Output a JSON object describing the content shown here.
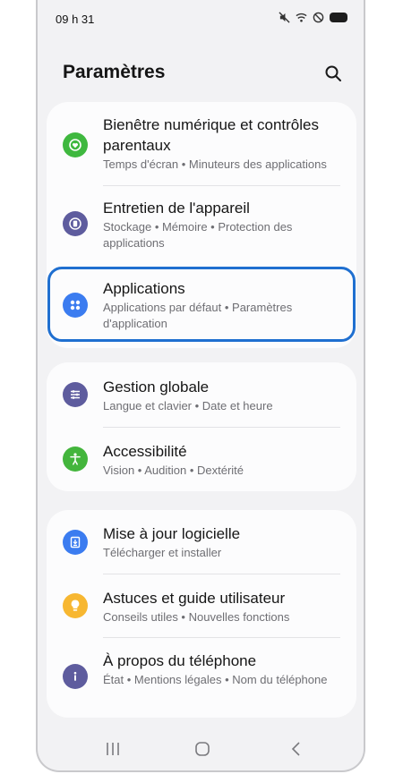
{
  "status_bar": {
    "time": "09 h 31",
    "icons": [
      "mute-icon",
      "wifi-icon",
      "do-not-disturb-icon",
      "battery-icon"
    ]
  },
  "header": {
    "title": "Paramètres",
    "search_icon": "search-icon"
  },
  "groups": [
    {
      "items": [
        {
          "title": "Bienêtre numérique et contrôles parentaux",
          "subtitle": "Temps d'écran  •  Minuteurs des applications",
          "icon": "digital-wellbeing-icon",
          "color": "#3fb83f"
        },
        {
          "title": "Entretien de l'appareil",
          "subtitle": "Stockage  •  Mémoire  •  Protection des applications",
          "icon": "device-care-icon",
          "color": "#5e5c9e"
        },
        {
          "title": "Applications",
          "subtitle": "Applications par défaut  •  Paramètres d'application",
          "icon": "apps-icon",
          "color": "#3b7cf0",
          "highlighted": true
        }
      ]
    },
    {
      "items": [
        {
          "title": "Gestion globale",
          "subtitle": "Langue et clavier  •  Date et heure",
          "icon": "general-management-icon",
          "color": "#5e5c9e"
        },
        {
          "title": "Accessibilité",
          "subtitle": "Vision  •  Audition  •  Dextérité",
          "icon": "accessibility-icon",
          "color": "#43b53c"
        }
      ]
    },
    {
      "items": [
        {
          "title": "Mise à jour logicielle",
          "subtitle": "Télécharger et installer",
          "icon": "software-update-icon",
          "color": "#3b7cf0"
        },
        {
          "title": "Astuces et guide utilisateur",
          "subtitle": "Conseils utiles  •  Nouvelles fonctions",
          "icon": "tips-icon",
          "color": "#f7b731"
        },
        {
          "title": "À propos du téléphone",
          "subtitle": "État  •  Mentions légales  •  Nom du téléphone",
          "icon": "about-phone-icon",
          "color": "#5e5c9e"
        }
      ]
    }
  ],
  "nav_bar": {
    "buttons": [
      "recent-apps-icon",
      "home-icon",
      "back-icon"
    ]
  },
  "colors": {
    "background": "#f2f2f4",
    "card": "#fcfcfd",
    "highlight_border": "#1f6fd0",
    "subtitle": "#6e6e73"
  }
}
